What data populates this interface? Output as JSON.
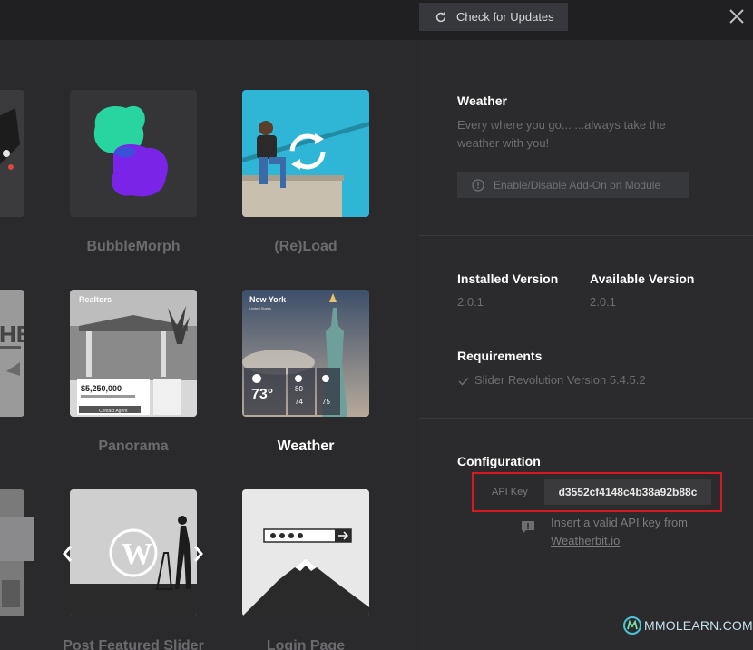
{
  "header": {
    "check_updates_label": "Check for Updates"
  },
  "gallery": {
    "items": [
      {
        "label": "BubbleMorph",
        "active": false
      },
      {
        "label": "(Re)Load",
        "active": false
      },
      {
        "label": "Panorama",
        "active": false
      },
      {
        "label": "Weather",
        "active": true
      },
      {
        "label": "Post Featured Slider",
        "active": false
      },
      {
        "label": "Login Page",
        "active": false
      }
    ],
    "panorama_thumb": {
      "brand": "Realtors",
      "price": "$5,250,000",
      "cta": "Contact Agent"
    },
    "weather_thumb": {
      "city": "New York",
      "region": "United States",
      "temp": "73°",
      "temp2": "80",
      "temp3": "74",
      "temp4": "75"
    }
  },
  "addon": {
    "title": "Weather",
    "description_line1": "Every where you go... ...always take the",
    "description_line2": "weather with you!",
    "toggle_label": "Enable/Disable Add-On on Module",
    "installed_version_label": "Installed Version",
    "installed_version": "2.0.1",
    "available_version_label": "Available Version",
    "available_version": "2.0.1",
    "requirements_label": "Requirements",
    "requirement": "Slider Revolution Version 5.4.5.2",
    "configuration_label": "Configuration",
    "api_key_label": "API Key",
    "api_key_value": "d3552cf4148c4b38a92b88c",
    "hint_line1": "Insert a valid API key from",
    "hint_link": "Weatherbit.io"
  },
  "watermark": {
    "text": "MMOLEARN.COM"
  },
  "colors": {
    "accent_red": "#d7191f",
    "panel_bg": "#2b2b2d",
    "gallery_bg": "#2a2a2c"
  }
}
